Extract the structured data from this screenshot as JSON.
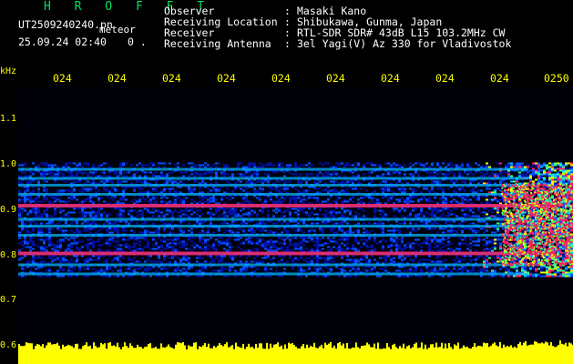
{
  "header": {
    "brand": "H R O F F T",
    "file_name": "UT2509240240.pn",
    "file_suffix": "meteor",
    "datetime": "25.09.24 02:40",
    "sub_value": "0 .",
    "info_rows": [
      {
        "label": "Observer",
        "value": "Masaki Kano"
      },
      {
        "label": "Receiving Location",
        "value": "Shibukawa, Gunma, Japan"
      },
      {
        "label": "Receiver",
        "value": "RTL-SDR SDR# 43dB L15 103.2MHz CW"
      },
      {
        "label": "Receiving Antenna",
        "value": "3el Yagi(V) Az 330 for Vladivostok"
      }
    ]
  },
  "chart_data": {
    "type": "heatmap",
    "ylabel": "kHz",
    "x_ticks": [
      "024",
      "024",
      "024",
      "024",
      "024",
      "024",
      "024",
      "024",
      "024",
      "0250"
    ],
    "y_ticks": [
      "1.1",
      "1.0",
      "0.9",
      "0.8",
      "0.7",
      "0.6"
    ],
    "ylim": [
      0.6,
      1.1
    ],
    "bands_khz": [
      0.99,
      0.97,
      0.955,
      0.935,
      0.91,
      0.88,
      0.865,
      0.845,
      0.805,
      0.78,
      0.76
    ],
    "strong_bands_khz": [
      0.91,
      0.805
    ],
    "palette": [
      "#000010",
      "#0010a0",
      "#0050ff",
      "#00c0ff",
      "#40ff80",
      "#e8ff00",
      "#ff2060"
    ],
    "level_bar_color": "#ffff00"
  }
}
